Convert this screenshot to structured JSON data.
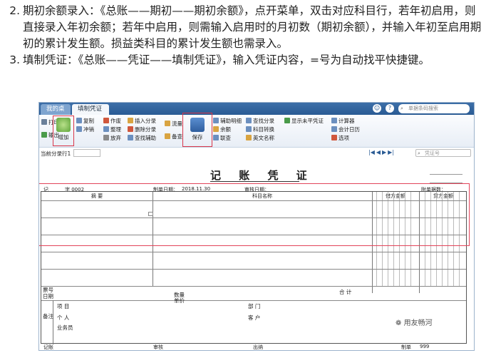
{
  "instructions": [
    {
      "num": "2.",
      "text": "期初余额录入：《总账——期初——期初余额》，点开菜单，双击对应科目行，若年初启用，则直接录入年初余额；若年中启用，则需输入启用时的月初数（期初余额），并输入年初至启用期初的累计发生额。损益类科目的累计发生额也需录入。"
    },
    {
      "num": "3.",
      "text": "填制凭证：《总账——凭证——填制凭证》，输入凭证内容，=号为自动找平快捷键。"
    }
  ],
  "app": {
    "tabs": [
      "我的桌面",
      "填制凭证"
    ],
    "search_placeholder": "单据条码搜索",
    "ribbon": {
      "print": "打印",
      "export": "输出",
      "add": "增加",
      "copy": "复制",
      "reverse": "冲销",
      "cancel_void": "作废",
      "tidy": "整理",
      "abandon": "放弃",
      "insert_entry": "插入分录",
      "delete_entry": "删除分录",
      "find_assist": "查找辅助",
      "flow": "流量",
      "check": "备查",
      "save": "保存",
      "assist_detail": "辅助明细",
      "balance": "余额",
      "link": "联查",
      "find_entry": "查找分录",
      "account_convert": "科目转换",
      "english_name": "英文名称",
      "show_unbalanced": "显示未平凭证",
      "calculator": "计算器",
      "calendar": "会计日历",
      "options": "选项"
    },
    "subbar": {
      "label": "当前分录行1",
      "search_placeholder": "凭证号"
    }
  },
  "voucher": {
    "title": "记 账 凭 证",
    "type_label": "记",
    "number": "字 0002",
    "date_label": "制单日期：",
    "date": "2018.11.30",
    "audit_date_label": "审核日期：",
    "attachments_label": "附单据数：",
    "col_summary": "摘 要",
    "col_account": "科目名称",
    "col_debit": "借方金额",
    "col_credit": "贷方金额",
    "bill_no": "票号",
    "date_row": "日期",
    "quantity": "数量",
    "unit_price": "单价",
    "total": "合 计",
    "remark": "备注",
    "project": "项 目",
    "department": "部 门",
    "personal": "个 人",
    "customer": "客 户",
    "salesperson": "业务员",
    "bookkeeper": "记账",
    "reviewer": "审核",
    "cashier": "出纳",
    "maker": "制单",
    "maker_name": "999"
  },
  "watermark": "用友畅河"
}
